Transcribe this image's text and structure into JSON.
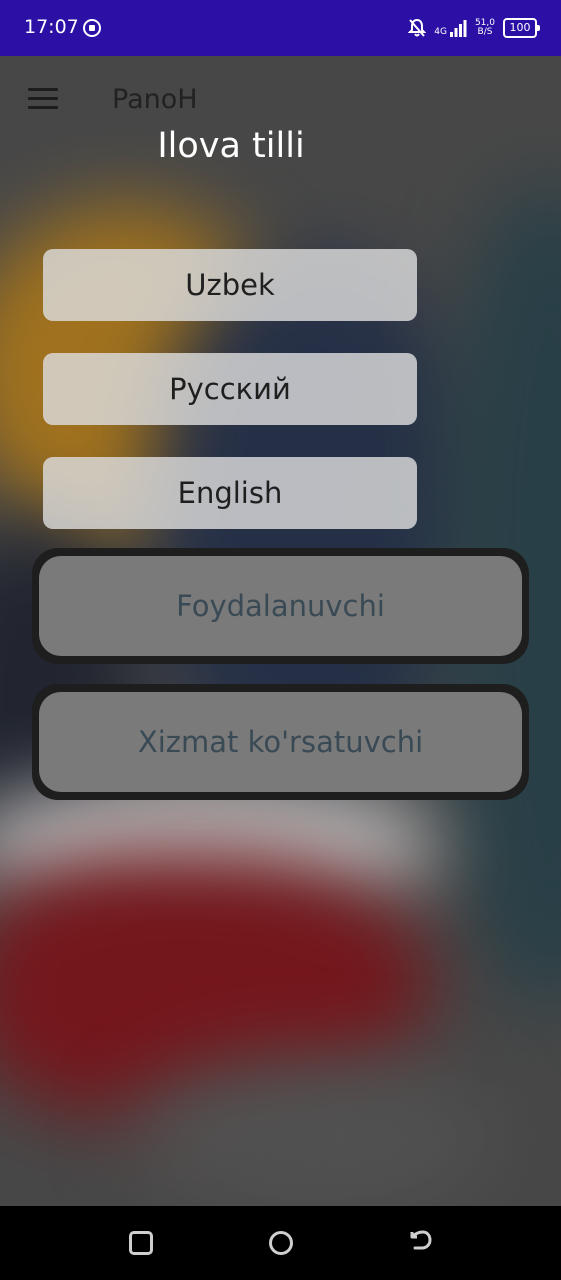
{
  "status_bar": {
    "time": "17:07",
    "network_type": "4G",
    "net_speed": "51,0",
    "net_speed_unit": "B/S",
    "battery": "100",
    "icons": [
      "app-notification-icon",
      "bell-off-icon",
      "signal-icon",
      "battery-icon"
    ]
  },
  "app_bar": {
    "title": "PanoH",
    "menu_icon": "hamburger-menu-icon"
  },
  "page": {
    "title": "Ilova tilli"
  },
  "languages": [
    {
      "label": "Uzbek"
    },
    {
      "label": "Русский"
    },
    {
      "label": "English"
    }
  ],
  "roles": [
    {
      "label": "Foydalanuvchi"
    },
    {
      "label": "Xizmat ko'rsatuvchi"
    }
  ],
  "nav_bar": {
    "icons": [
      "recents-icon",
      "home-icon",
      "back-icon"
    ]
  },
  "colors": {
    "status_bar": "#2c10a6",
    "nav_bar": "#000000",
    "language_button": "#dcdcdc",
    "role_button": "#7a7a7a",
    "role_button_border": "#1e1e1e"
  }
}
